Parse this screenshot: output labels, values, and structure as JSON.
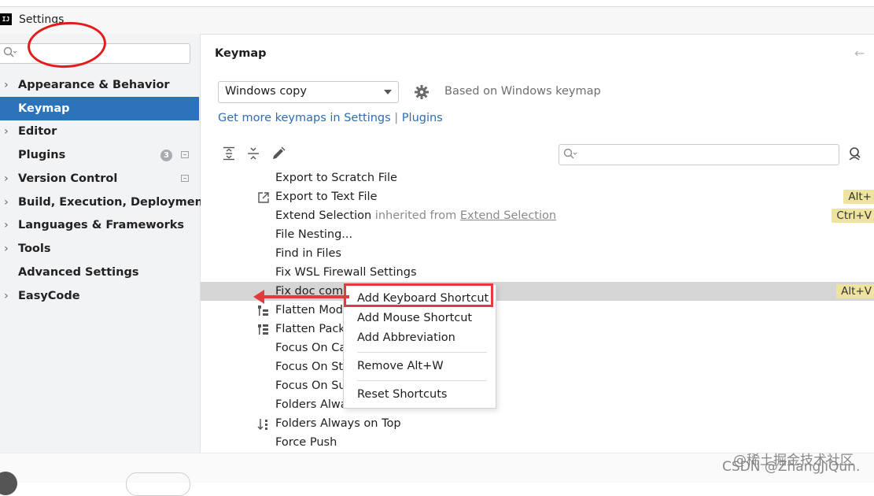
{
  "window": {
    "title": "Settings",
    "app_icon": "IJ"
  },
  "sidebar": {
    "search_placeholder": "",
    "items": [
      {
        "label": "Appearance & Behavior",
        "chevron": "›",
        "selected": false
      },
      {
        "label": "Keymap",
        "chevron": "",
        "selected": true
      },
      {
        "label": "Editor",
        "chevron": "›",
        "selected": false
      },
      {
        "label": "Plugins",
        "chevron": "",
        "selected": false,
        "badge": "3"
      },
      {
        "label": "Version Control",
        "chevron": "›",
        "selected": false
      },
      {
        "label": "Build, Execution, Deployment",
        "chevron": "›",
        "selected": false
      },
      {
        "label": "Languages & Frameworks",
        "chevron": "›",
        "selected": false
      },
      {
        "label": "Tools",
        "chevron": "›",
        "selected": false
      },
      {
        "label": "Advanced Settings",
        "chevron": "",
        "selected": false
      },
      {
        "label": "EasyCode",
        "chevron": "›",
        "selected": false
      }
    ]
  },
  "main": {
    "title": "Keymap",
    "back_arrow": "←",
    "keymap_select_value": "Windows copy",
    "based_on": "Based on Windows keymap",
    "link_settings": "Get more keymaps in Settings",
    "link_sep": "|",
    "link_plugins": "Plugins",
    "search_placeholder": ""
  },
  "actions": [
    {
      "label": "Export to Scratch File",
      "shortcut": ""
    },
    {
      "label": "Export to Text File",
      "shortcut": "Alt+",
      "icon": "export-icon"
    },
    {
      "label": "Extend Selection",
      "inherited_text": "inherited from",
      "inherited_link": "Extend Selection",
      "shortcut": "Ctrl+V"
    },
    {
      "label": "File Nesting...",
      "shortcut": ""
    },
    {
      "label": "Find in Files",
      "shortcut": ""
    },
    {
      "label": "Fix WSL Firewall Settings",
      "shortcut": ""
    },
    {
      "label": "Fix doc com",
      "shortcut": "Alt+V",
      "highlighted": true
    },
    {
      "label": "Flatten Modu",
      "shortcut": "",
      "icon": "flatten-modules-icon"
    },
    {
      "label": "Flatten Packa",
      "shortcut": "",
      "icon": "flatten-packages-icon"
    },
    {
      "label": "Focus On Ca",
      "shortcut": ""
    },
    {
      "label": "Focus On Sta",
      "shortcut": ""
    },
    {
      "label": "Focus On Su",
      "shortcut": ""
    },
    {
      "label": "Folders Alwa",
      "shortcut": ""
    },
    {
      "label": "Folders Always on Top",
      "shortcut": "",
      "icon": "sort-icon"
    },
    {
      "label": "Force Push",
      "shortcut": ""
    }
  ],
  "context_menu": {
    "items": [
      "Add Keyboard Shortcut",
      "Add Mouse Shortcut",
      "Add Abbreviation",
      "Remove Alt+W",
      "Reset Shortcuts"
    ]
  },
  "watermarks": {
    "line1": "@稀土掘金技术社区",
    "line2": "CSDN @ZhangJiQun."
  },
  "colors": {
    "selection": "#2d73b9",
    "link": "#2f6cb5",
    "shortcut_bg": "#eee4a0",
    "annotation_red": "#e13b3b"
  }
}
